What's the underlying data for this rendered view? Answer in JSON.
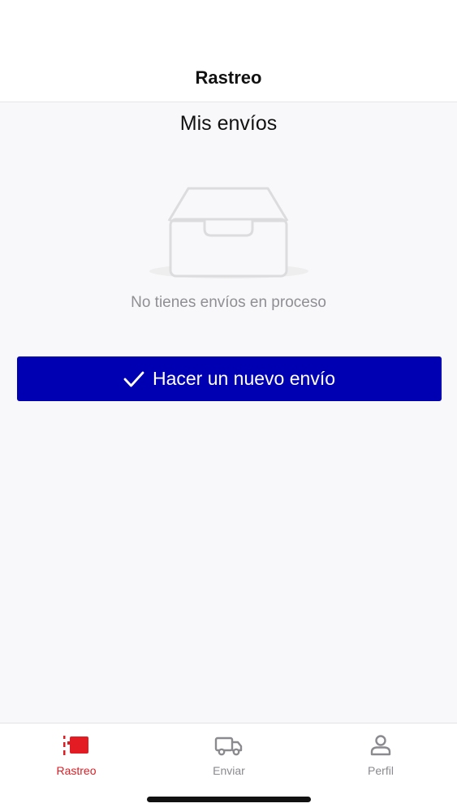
{
  "header": {
    "title": "Rastreo"
  },
  "main": {
    "section_title": "Mis envíos",
    "empty_illustration": "empty-inbox-tray",
    "empty_message": "No tienes envíos en proceso",
    "primary_button": {
      "label": "Hacer un nuevo envío",
      "icon": "checkmark-icon"
    }
  },
  "tab_bar": {
    "tabs": [
      {
        "label": "Rastreo",
        "icon": "tracking-icon",
        "active": true
      },
      {
        "label": "Enviar",
        "icon": "truck-icon",
        "active": false
      },
      {
        "label": "Perfil",
        "icon": "person-icon",
        "active": false
      }
    ]
  },
  "colors": {
    "accent": "#d71f26",
    "primary_button": "#0000b3",
    "inactive_tab": "#8a8a8f",
    "empty_text": "#8f8f94"
  }
}
